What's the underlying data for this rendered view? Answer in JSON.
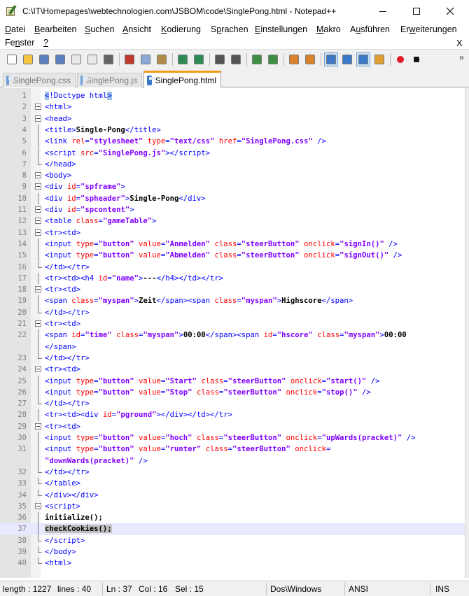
{
  "window": {
    "title": "C:\\IT\\Homepages\\webtechnologien.com\\JSBOM\\code\\SinglePong.html - Notepad++",
    "icon": "notepadpp-icon",
    "controls": [
      "minimize-icon",
      "maximize-icon",
      "close-icon"
    ]
  },
  "menu": {
    "items": [
      {
        "pre": "",
        "acc": "D",
        "post": "atei"
      },
      {
        "pre": "",
        "acc": "B",
        "post": "earbeiten"
      },
      {
        "pre": "",
        "acc": "S",
        "post": "uchen"
      },
      {
        "pre": "",
        "acc": "A",
        "post": "nsicht"
      },
      {
        "pre": "",
        "acc": "K",
        "post": "odierung"
      },
      {
        "pre": "S",
        "acc": "p",
        "post": "rachen"
      },
      {
        "pre": "",
        "acc": "E",
        "post": "instellungen"
      },
      {
        "pre": "",
        "acc": "M",
        "post": "akro"
      },
      {
        "pre": "A",
        "acc": "u",
        "post": "sführen"
      },
      {
        "pre": "Er",
        "acc": "w",
        "post": "eiterungen"
      },
      {
        "pre": "Fe",
        "acc": "n",
        "post": "ster"
      },
      {
        "pre": "",
        "acc": "?",
        "post": ""
      }
    ],
    "close_doc": "X"
  },
  "toolbar": {
    "icons": [
      "new-file-icon",
      "open-file-icon",
      "save-icon",
      "save-all-icon",
      "close-icon",
      "close-all-icon",
      "print-icon",
      "cut-icon",
      "copy-icon",
      "paste-icon",
      "undo-icon",
      "redo-icon",
      "find-icon",
      "replace-icon",
      "zoom-in-icon",
      "zoom-out-icon",
      "sync-vertical-icon",
      "sync-horizontal-icon",
      "word-wrap-icon",
      "show-all-chars-icon",
      "indent-guide-icon",
      "doc-map-icon",
      "record-macro-icon",
      "stop-record-icon"
    ],
    "overflow": "»",
    "colors": {
      "accent_active": "#3c78c8",
      "record": "#e01b24"
    }
  },
  "tabs": [
    {
      "label": "SinglePong.css",
      "active": false
    },
    {
      "label": "SinglePong.js",
      "active": false
    },
    {
      "label": "SinglePong.html",
      "active": true
    }
  ],
  "editor": {
    "current_line": 37,
    "colors": {
      "tag": "#0000ff",
      "attribute": "#ff0000",
      "value": "#8000ff",
      "line_highlight": "#e8e8ff",
      "tab_accent": "#f39a1e"
    },
    "rows": [
      {
        "n": "1",
        "fold": "",
        "html": "<span class='brace-hl t'>&lt;</span><span class='t'>!Doctype html</span><span class='brace-hl t'>&gt;</span>"
      },
      {
        "n": "2",
        "fold": "box",
        "html": "<span class='t'>&lt;html&gt;</span>"
      },
      {
        "n": "3",
        "fold": "box",
        "html": "<span class='t'>&lt;head&gt;</span>"
      },
      {
        "n": "4",
        "fold": "line",
        "html": "<span class='t'>&lt;title&gt;</span><span class='x'>Single-Pong</span><span class='t'>&lt;/title&gt;</span>"
      },
      {
        "n": "5",
        "fold": "line",
        "html": "<span class='t'>&lt;link </span><span class='a'>rel</span><span class='t'>=</span><span class='v'>\"stylesheet\"</span><span class='t'> </span><span class='a'>type</span><span class='t'>=</span><span class='v'>\"text/css\"</span><span class='t'> </span><span class='a'>href</span><span class='t'>=</span><span class='v'>\"SinglePong.css\"</span><span class='t'> /&gt;</span>"
      },
      {
        "n": "6",
        "fold": "line",
        "html": "<span class='t'>&lt;script </span><span class='a'>src</span><span class='t'>=</span><span class='v'>\"SinglePong.js\"</span><span class='t'>&gt;&lt;/script&gt;</span>"
      },
      {
        "n": "7",
        "fold": "end",
        "html": "<span class='t'>&lt;/head&gt;</span>"
      },
      {
        "n": "8",
        "fold": "box",
        "html": "<span class='t'>&lt;body&gt;</span>"
      },
      {
        "n": "9",
        "fold": "box",
        "html": "<span class='t'>&lt;div </span><span class='a'>id</span><span class='t'>=</span><span class='v'>\"spframe\"</span><span class='t'>&gt;</span>"
      },
      {
        "n": "10",
        "fold": "line",
        "html": "<span class='t'>&lt;div </span><span class='a'>id</span><span class='t'>=</span><span class='v'>\"spheader\"</span><span class='t'>&gt;</span><span class='x'>Single-Pong</span><span class='t'>&lt;/div&gt;</span>"
      },
      {
        "n": "11",
        "fold": "box",
        "html": "<span class='t'>&lt;div </span><span class='a'>id</span><span class='t'>=</span><span class='v'>\"spcontent\"</span><span class='t'>&gt;</span>"
      },
      {
        "n": "12",
        "fold": "box",
        "html": "<span class='t'>&lt;table </span><span class='a'>class</span><span class='t'>=</span><span class='v'>\"gameTable\"</span><span class='t'>&gt;</span>"
      },
      {
        "n": "13",
        "fold": "box",
        "html": "<span class='t'>&lt;tr&gt;&lt;td&gt;</span>"
      },
      {
        "n": "14",
        "fold": "line",
        "html": "<span class='t'>&lt;input </span><span class='a'>type</span><span class='t'>=</span><span class='v'>\"button\"</span><span class='t'> </span><span class='a'>value</span><span class='t'>=</span><span class='v'>\"Anmelden\"</span><span class='t'> </span><span class='a'>class</span><span class='t'>=</span><span class='v'>\"steerButton\"</span><span class='t'> </span><span class='a'>onclick</span><span class='t'>=</span><span class='v'>\"signIn()\"</span><span class='t'> /&gt;</span>"
      },
      {
        "n": "15",
        "fold": "line",
        "html": "<span class='t'>&lt;input </span><span class='a'>type</span><span class='t'>=</span><span class='v'>\"button\"</span><span class='t'> </span><span class='a'>value</span><span class='t'>=</span><span class='v'>\"Abmelden\"</span><span class='t'> </span><span class='a'>class</span><span class='t'>=</span><span class='v'>\"steerButton\"</span><span class='t'> </span><span class='a'>onclick</span><span class='t'>=</span><span class='v'>\"signOut()\"</span><span class='t'> /&gt;</span>"
      },
      {
        "n": "16",
        "fold": "end",
        "html": "<span class='t'>&lt;/td&gt;&lt;/tr&gt;</span>"
      },
      {
        "n": "17",
        "fold": "line",
        "html": "<span class='t'>&lt;tr&gt;&lt;td&gt;&lt;h4 </span><span class='a'>id</span><span class='t'>=</span><span class='v'>\"name\"</span><span class='t'>&gt;</span><span class='x'>---</span><span class='t'>&lt;/h4&gt;&lt;/td&gt;&lt;/tr&gt;</span>"
      },
      {
        "n": "18",
        "fold": "box",
        "html": "<span class='t'>&lt;tr&gt;&lt;td&gt;</span>"
      },
      {
        "n": "19",
        "fold": "line",
        "html": "<span class='t'>&lt;span </span><span class='a'>class</span><span class='t'>=</span><span class='v'>\"myspan\"</span><span class='t'>&gt;</span><span class='x'>Zeit</span><span class='t'>&lt;/span&gt;&lt;span </span><span class='a'>class</span><span class='t'>=</span><span class='v'>\"myspan\"</span><span class='t'>&gt;</span><span class='x'>Highscore</span><span class='t'>&lt;/span&gt;</span>"
      },
      {
        "n": "20",
        "fold": "end",
        "html": "<span class='t'>&lt;/td&gt;&lt;/tr&gt;</span>"
      },
      {
        "n": "21",
        "fold": "box",
        "html": "<span class='t'>&lt;tr&gt;&lt;td&gt;</span>"
      },
      {
        "n": "22",
        "fold": "line",
        "html": "<span class='t'>&lt;span </span><span class='a'>id</span><span class='t'>=</span><span class='v'>\"time\"</span><span class='t'> </span><span class='a'>class</span><span class='t'>=</span><span class='v'>\"myspan\"</span><span class='t'>&gt;</span><span class='x'>00:00</span><span class='t'>&lt;/span&gt;&lt;span </span><span class='a'>id</span><span class='t'>=</span><span class='v'>\"hscore\"</span><span class='t'> </span><span class='a'>class</span><span class='t'>=</span><span class='v'>\"myspan\"</span><span class='t'>&gt;</span><span class='x'>00:00</span>"
      },
      {
        "n": "",
        "fold": "line",
        "html": "<span class='t'>&lt;/span&gt;</span>"
      },
      {
        "n": "23",
        "fold": "end",
        "html": "<span class='t'>&lt;/td&gt;&lt;/tr&gt;</span>"
      },
      {
        "n": "24",
        "fold": "box",
        "html": "<span class='t'>&lt;tr&gt;&lt;td&gt;</span>"
      },
      {
        "n": "25",
        "fold": "line",
        "html": "<span class='t'>&lt;input </span><span class='a'>type</span><span class='t'>=</span><span class='v'>\"button\"</span><span class='t'> </span><span class='a'>value</span><span class='t'>=</span><span class='v'>\"Start\"</span><span class='t'> </span><span class='a'>class</span><span class='t'>=</span><span class='v'>\"steerButton\"</span><span class='t'> </span><span class='a'>onclick</span><span class='t'>=</span><span class='v'>\"start()\"</span><span class='t'> /&gt;</span>"
      },
      {
        "n": "26",
        "fold": "line",
        "html": "<span class='t'>&lt;input </span><span class='a'>type</span><span class='t'>=</span><span class='v'>\"button\"</span><span class='t'> </span><span class='a'>value</span><span class='t'>=</span><span class='v'>\"Stop\"</span><span class='t'> </span><span class='a'>class</span><span class='t'>=</span><span class='v'>\"steerButton\"</span><span class='t'> </span><span class='a'>onclick</span><span class='t'>=</span><span class='v'>\"stop()\"</span><span class='t'> /&gt;</span>"
      },
      {
        "n": "27",
        "fold": "end",
        "html": "<span class='t'>&lt;/td&gt;&lt;/tr&gt;</span>"
      },
      {
        "n": "28",
        "fold": "line",
        "html": "<span class='t'>&lt;tr&gt;&lt;td&gt;&lt;div </span><span class='a'>id</span><span class='t'>=</span><span class='v'>\"pground\"</span><span class='t'>&gt;&lt;/div&gt;&lt;/td&gt;&lt;/tr&gt;</span>"
      },
      {
        "n": "29",
        "fold": "box",
        "html": "<span class='t'>&lt;tr&gt;&lt;td&gt;</span>"
      },
      {
        "n": "30",
        "fold": "line",
        "html": "<span class='t'>&lt;input </span><span class='a'>type</span><span class='t'>=</span><span class='v'>\"button\"</span><span class='t'> </span><span class='a'>value</span><span class='t'>=</span><span class='v'>\"hoch\"</span><span class='t'> </span><span class='a'>class</span><span class='t'>=</span><span class='v'>\"steerButton\"</span><span class='t'> </span><span class='a'>onclick</span><span class='t'>=</span><span class='v'>\"upWards(pracket)\"</span><span class='t'> /&gt;</span>"
      },
      {
        "n": "31",
        "fold": "line",
        "html": "<span class='t'>&lt;input </span><span class='a'>type</span><span class='t'>=</span><span class='v'>\"button\"</span><span class='t'> </span><span class='a'>value</span><span class='t'>=</span><span class='v'>\"runter\"</span><span class='t'> </span><span class='a'>class</span><span class='t'>=</span><span class='v'>\"steerButton\"</span><span class='t'> </span><span class='a'>onclick</span><span class='t'>=</span>"
      },
      {
        "n": "",
        "fold": "line",
        "html": "<span class='v'>\"downWards(pracket)\"</span><span class='t'> /&gt;</span>"
      },
      {
        "n": "32",
        "fold": "end",
        "html": "<span class='t'>&lt;/td&gt;&lt;/tr&gt;</span>"
      },
      {
        "n": "33",
        "fold": "end",
        "html": "<span class='t'>&lt;/table&gt;</span>"
      },
      {
        "n": "34",
        "fold": "end",
        "html": "<span class='t'>&lt;/div&gt;&lt;/div&gt;</span>"
      },
      {
        "n": "35",
        "fold": "box",
        "html": "<span class='t'>&lt;script&gt;</span>"
      },
      {
        "n": "36",
        "fold": "line",
        "html": "<span class='x'>initialize();</span>"
      },
      {
        "n": "37",
        "fold": "line",
        "html": "<span class='x sel-bg'>checkCookies();</span>"
      },
      {
        "n": "38",
        "fold": "end",
        "html": "<span class='t'>&lt;/script&gt;</span>"
      },
      {
        "n": "39",
        "fold": "end",
        "html": "<span class='t'>&lt;/body&gt;</span>"
      },
      {
        "n": "40",
        "fold": "end",
        "html": "<span class='t'>&lt;html&gt;</span>"
      }
    ]
  },
  "status": {
    "length": "length : 1227",
    "lines": "lines : 40",
    "ln": "Ln : 37",
    "col": "Col : 16",
    "sel": "Sel : 15",
    "eol": "Dos\\Windows",
    "encoding": "ANSI",
    "mode": "INS"
  }
}
